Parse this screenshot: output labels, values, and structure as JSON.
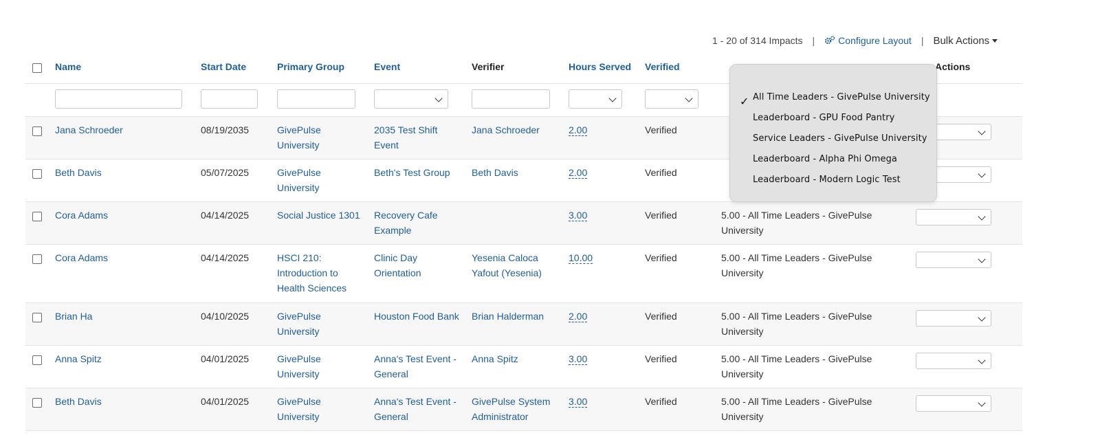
{
  "toolbar": {
    "count_text": "1 - 20 of 314 Impacts",
    "configure_label": "Configure Layout",
    "bulk_label": "Bulk Actions"
  },
  "headers": {
    "name": "Name",
    "start_date": "Start Date",
    "primary_group": "Primary Group",
    "event": "Event",
    "verifier": "Verifier",
    "hours_served": "Hours Served",
    "verified": "Verified",
    "actions": "Actions"
  },
  "rows": [
    {
      "name": "Jana Schroeder",
      "date": "08/19/2035",
      "group": [
        "GivePulse",
        "University"
      ],
      "event": [
        "2035 Test Shift",
        "Event"
      ],
      "verifier": [
        "Jana Schroeder"
      ],
      "hours": "2.00",
      "verified": "Verified",
      "leaderboard": []
    },
    {
      "name": "Beth Davis",
      "date": "05/07/2025",
      "group": [
        "GivePulse",
        "University"
      ],
      "event": [
        "Beth's Test Group"
      ],
      "verifier": [
        "Beth Davis"
      ],
      "hours": "2.00",
      "verified": "Verified",
      "leaderboard": []
    },
    {
      "name": "Cora Adams",
      "date": "04/14/2025",
      "group": [
        "Social Justice 1301"
      ],
      "event": [
        "Recovery Cafe",
        "Example"
      ],
      "verifier": [],
      "hours": "3.00",
      "verified": "Verified",
      "leaderboard": [
        "5.00 - All Time Leaders - GivePulse",
        "University"
      ]
    },
    {
      "name": "Cora Adams",
      "date": "04/14/2025",
      "group": [
        "HSCI 210:",
        "Introduction to",
        "Health Sciences"
      ],
      "event": [
        "Clinic Day",
        "Orientation"
      ],
      "verifier": [
        "Yesenia Caloca",
        "Yafout (Yesenia)"
      ],
      "hours": "10.00",
      "verified": "Verified",
      "leaderboard": [
        "5.00 - All Time Leaders - GivePulse",
        "University"
      ]
    },
    {
      "name": "Brian Ha",
      "date": "04/10/2025",
      "group": [
        "GivePulse",
        "University"
      ],
      "event": [
        "Houston Food Bank"
      ],
      "verifier": [
        "Brian Halderman"
      ],
      "hours": "2.00",
      "verified": "Verified",
      "leaderboard": [
        "5.00 - All Time Leaders - GivePulse",
        "University"
      ]
    },
    {
      "name": "Anna Spitz",
      "date": "04/01/2025",
      "group": [
        "GivePulse",
        "University"
      ],
      "event": [
        "Anna's Test Event -",
        "General"
      ],
      "verifier": [
        "Anna Spitz"
      ],
      "hours": "3.00",
      "verified": "Verified",
      "leaderboard": [
        "5.00 - All Time Leaders - GivePulse",
        "University"
      ]
    },
    {
      "name": "Beth Davis",
      "date": "04/01/2025",
      "group": [
        "GivePulse",
        "University"
      ],
      "event": [
        "Anna's Test Event -",
        "General"
      ],
      "verifier": [
        "GivePulse System",
        "Administrator"
      ],
      "hours": "3.00",
      "verified": "Verified",
      "leaderboard": [
        "5.00 - All Time Leaders - GivePulse",
        "University"
      ]
    }
  ],
  "leaderboard_menu": {
    "options": [
      "All Time Leaders - GivePulse University",
      "Leaderboard - GPU Food Pantry",
      "Service Leaders - GivePulse University",
      "Leaderboard - Alpha Phi Omega",
      "Leaderboard - Modern Logic Test"
    ],
    "selected": "All Time Leaders - GivePulse University"
  },
  "colors": {
    "link": "#1f5e99",
    "alt_row": "#f7f7f7",
    "popover": "#e2e2e2"
  }
}
